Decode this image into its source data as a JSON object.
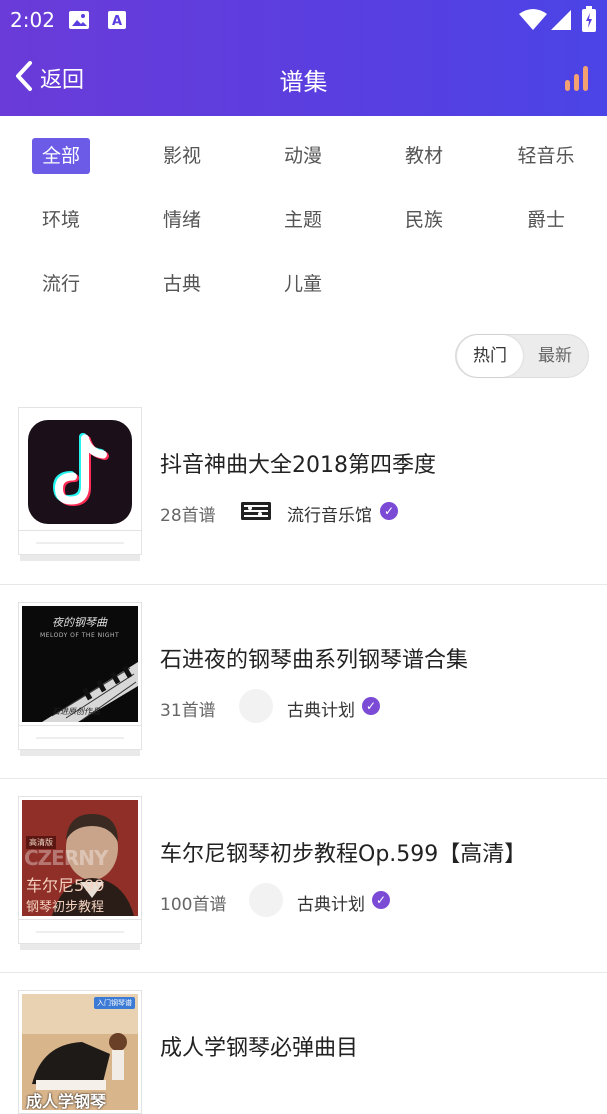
{
  "status_bar": {
    "time": "2:02",
    "icons": [
      "image-icon",
      "a-notification-icon",
      "wifi-icon",
      "signal-icon",
      "battery-icon"
    ]
  },
  "nav": {
    "back_label": "返回",
    "title": "谱集",
    "right_icon": "ranking-bars-icon"
  },
  "colors": {
    "header_start": "#6a3bd8",
    "header_end": "#4b44e6",
    "accent": "#6b5be6",
    "verified": "#7b4bd6",
    "rank_icon": "#f3a072"
  },
  "categories": [
    "全部",
    "影视",
    "动漫",
    "教材",
    "轻音乐",
    "环境",
    "情绪",
    "主题",
    "民族",
    "爵士",
    "流行",
    "古典",
    "儿童"
  ],
  "active_category": "全部",
  "sort": {
    "hot": "热门",
    "newest": "最新",
    "selected": "热门"
  },
  "items": [
    {
      "name": "抖音神曲大全2018第四季度",
      "count": "28首谱",
      "author": "流行音乐馆",
      "verified": true,
      "cover_text": ""
    },
    {
      "name": "石进夜的钢琴曲系列钢琴谱合集",
      "count": "31首谱",
      "author": "古典计划",
      "verified": true,
      "cover_title": "夜的钢琴曲",
      "cover_subtitle": "MELODY OF THE NIGHT",
      "cover_footer": "石进原创作品"
    },
    {
      "name": "车尔尼钢琴初步教程Op.599【高清】",
      "count": "100首谱",
      "author": "古典计划",
      "verified": true,
      "cover_badge": "高清版",
      "cover_big": "CZERNY",
      "cover_title": "车尔尼599",
      "cover_subtitle": "钢琴初步教程"
    },
    {
      "name": "成人学钢琴必弹曲目",
      "count": "",
      "author": "",
      "verified": false,
      "cover_title": "成人学钢琴",
      "cover_badge": "入门钢琴谱"
    }
  ]
}
